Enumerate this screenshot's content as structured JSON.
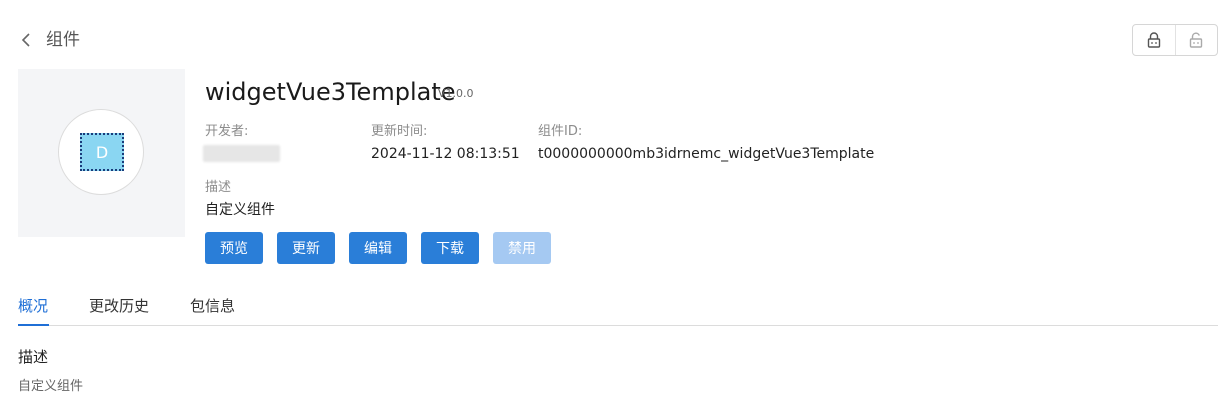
{
  "header": {
    "breadcrumb": "组件",
    "back_icon": "chevron-left-icon",
    "lock_icon": "lock-icon",
    "unlock_icon": "unlock-icon"
  },
  "widget": {
    "avatar_letter": "D",
    "avatar_color": "#8ad6f2",
    "name": "widgetVue3Template",
    "version": "V1.0.0",
    "developer_label": "开发者:",
    "developer_value": "",
    "updated_label": "更新时间:",
    "updated_value": "2024-11-12 08:13:51",
    "id_label": "组件ID:",
    "id_value": "t0000000000mb3idrnemc_widgetVue3Template",
    "desc_label": "描述",
    "desc_value": "自定义组件"
  },
  "actions": {
    "preview": "预览",
    "update": "更新",
    "edit": "编辑",
    "download": "下载",
    "disable": "禁用",
    "primary_color": "#2a7ed8",
    "disabled_color": "#a5c9f2"
  },
  "tabs": [
    {
      "label": "概况",
      "active": true
    },
    {
      "label": "更改历史",
      "active": false
    },
    {
      "label": "包信息",
      "active": false
    }
  ],
  "overview": {
    "section_title": "描述",
    "section_text": "自定义组件"
  }
}
